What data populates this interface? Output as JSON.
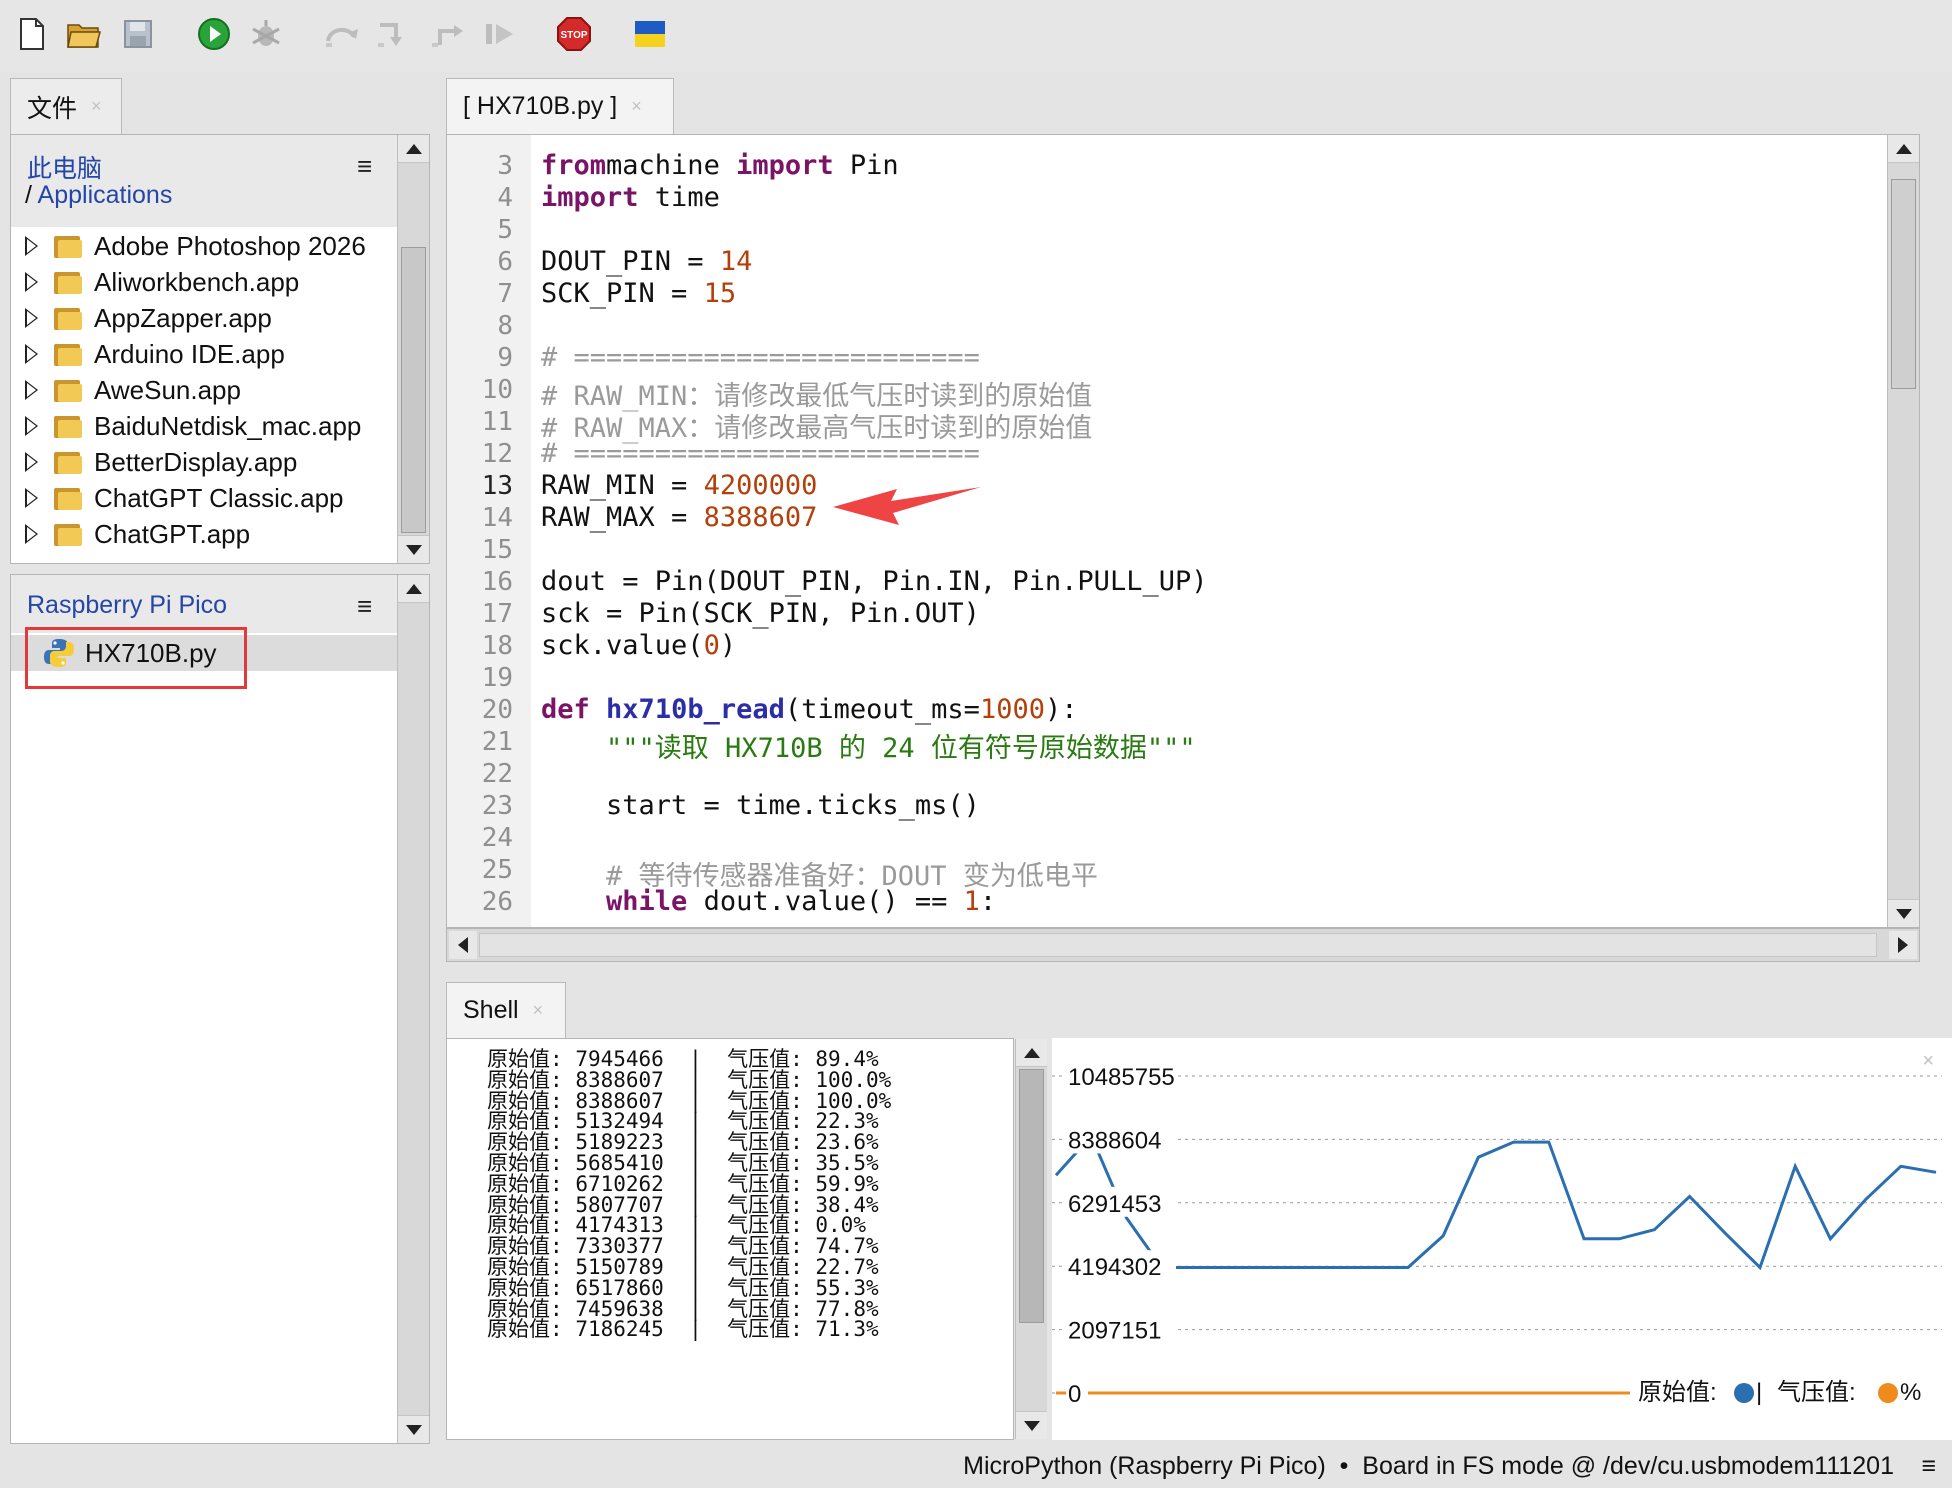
{
  "toolbar": {
    "icons": [
      "new-file-icon",
      "open-folder-icon",
      "save-icon",
      "run-icon",
      "debug-icon",
      "step-over-icon",
      "step-into-icon",
      "step-out-icon",
      "resume-icon",
      "stop-icon",
      "flag-icon"
    ],
    "stop_text": "STOP"
  },
  "files_tab": {
    "label": "文件",
    "close": "×"
  },
  "computer": {
    "title": "此电脑",
    "path_sep": "/",
    "path": "Applications",
    "items": [
      "Adobe Photoshop 2026",
      "Aliworkbench.app",
      "AppZapper.app",
      "Arduino IDE.app",
      "AweSun.app",
      "BaiduNetdisk_mac.app",
      "BetterDisplay.app",
      "ChatGPT Classic.app",
      "ChatGPT.app"
    ]
  },
  "device": {
    "title": "Raspberry Pi Pico",
    "file": "HX710B.py"
  },
  "editor_tab": {
    "label": "[ HX710B.py ]",
    "close": "×"
  },
  "editor": {
    "lines": [
      {
        "n": "3",
        "parts": [
          [
            "kw",
            "from"
          ],
          [
            "",
            "machine "
          ],
          [
            "kw",
            "import"
          ],
          [
            "",
            " Pin"
          ]
        ]
      },
      {
        "n": "4",
        "parts": [
          [
            "kw",
            "import"
          ],
          [
            "",
            " time"
          ]
        ]
      },
      {
        "n": "5",
        "parts": []
      },
      {
        "n": "6",
        "parts": [
          [
            "",
            "DOUT_PIN = "
          ],
          [
            "num",
            "14"
          ]
        ]
      },
      {
        "n": "7",
        "parts": [
          [
            "",
            "SCK_PIN = "
          ],
          [
            "num",
            "15"
          ]
        ]
      },
      {
        "n": "8",
        "parts": []
      },
      {
        "n": "9",
        "parts": [
          [
            "cm",
            "# ========================="
          ]
        ]
      },
      {
        "n": "10",
        "parts": [
          [
            "cm",
            "# RAW_MIN：请修改最低气压时读到的原始值"
          ]
        ]
      },
      {
        "n": "11",
        "parts": [
          [
            "cm",
            "# RAW_MAX：请修改最高气压时读到的原始值"
          ]
        ]
      },
      {
        "n": "12",
        "parts": [
          [
            "cm",
            "# ========================="
          ]
        ]
      },
      {
        "n": "13",
        "parts": [
          [
            "",
            "RAW_MIN = "
          ],
          [
            "num",
            "4200000"
          ]
        ]
      },
      {
        "n": "14",
        "parts": [
          [
            "",
            "RAW_MAX = "
          ],
          [
            "num",
            "8388607"
          ]
        ]
      },
      {
        "n": "15",
        "parts": []
      },
      {
        "n": "16",
        "parts": [
          [
            "",
            "dout = Pin(DOUT_PIN, Pin.IN, Pin.PULL_UP)"
          ]
        ]
      },
      {
        "n": "17",
        "parts": [
          [
            "",
            "sck = Pin(SCK_PIN, Pin.OUT)"
          ]
        ]
      },
      {
        "n": "18",
        "parts": [
          [
            "",
            "sck.value("
          ],
          [
            "num",
            "0"
          ],
          [
            "",
            ")"
          ]
        ]
      },
      {
        "n": "19",
        "parts": []
      },
      {
        "n": "20",
        "parts": [
          [
            "kw",
            "def"
          ],
          [
            "",
            " "
          ],
          [
            "fn",
            "hx710b_read"
          ],
          [
            "",
            "(timeout_ms="
          ],
          [
            "num",
            "1000"
          ],
          [
            "",
            "):"
          ]
        ]
      },
      {
        "n": "21",
        "parts": [
          [
            "",
            "    "
          ],
          [
            "str",
            "\"\"\"读取 HX710B 的 24 位有符号原始数据\"\"\""
          ]
        ]
      },
      {
        "n": "22",
        "parts": []
      },
      {
        "n": "23",
        "parts": [
          [
            "",
            "    start = time.ticks_ms()"
          ]
        ]
      },
      {
        "n": "24",
        "parts": []
      },
      {
        "n": "25",
        "parts": [
          [
            "",
            "    "
          ],
          [
            "cm",
            "# 等待传感器准备好：DOUT 变为低电平"
          ]
        ]
      },
      {
        "n": "26",
        "parts": [
          [
            "",
            "    "
          ],
          [
            "kw",
            "while"
          ],
          [
            "",
            " dout.value() == "
          ],
          [
            "num",
            "1"
          ],
          [
            "",
            ":"
          ]
        ]
      }
    ]
  },
  "shell_tab": {
    "label": "Shell",
    "close": "×"
  },
  "shell": {
    "raw_label": "原始值:",
    "pressure_label": "气压值:",
    "sep": "|",
    "rows": [
      {
        "raw": "7945466",
        "p": "89.4%"
      },
      {
        "raw": "8388607",
        "p": "100.0%"
      },
      {
        "raw": "8388607",
        "p": "100.0%"
      },
      {
        "raw": "5132494",
        "p": "22.3%"
      },
      {
        "raw": "5189223",
        "p": "23.6%"
      },
      {
        "raw": "5685410",
        "p": "35.5%"
      },
      {
        "raw": "6710262",
        "p": "59.9%"
      },
      {
        "raw": "5807707",
        "p": "38.4%"
      },
      {
        "raw": "4174313",
        "p": "0.0%"
      },
      {
        "raw": "7330377",
        "p": "74.7%"
      },
      {
        "raw": "5150789",
        "p": "22.7%"
      },
      {
        "raw": "6517860",
        "p": "55.3%"
      },
      {
        "raw": "7459638",
        "p": "77.8%"
      },
      {
        "raw": "7186245",
        "p": "71.3%"
      }
    ]
  },
  "plotter": {
    "close": "×",
    "legend": {
      "s1": "原始值:",
      "sep": " | ",
      "s2": "气压值:",
      "unit": "%"
    },
    "colors": {
      "raw": "#2a6fb0",
      "pressure": "#f08a1c"
    }
  },
  "chart_data": {
    "type": "line",
    "y_ticks": [
      "10485755",
      "8388604",
      "6291453",
      "4194302",
      "2097151",
      "0"
    ],
    "ylim": [
      0,
      10485755
    ],
    "grid": true,
    "legend_position": "bottom-right",
    "series": [
      {
        "name": "原始值",
        "values": [
          7200000,
          8500000,
          5800000,
          4150000,
          4150000,
          4150000,
          4150000,
          4150000,
          4150000,
          4150000,
          4150000,
          5200000,
          7800000,
          8300000,
          8300000,
          5100000,
          5100000,
          5400000,
          6500000,
          5300000,
          4150000,
          7500000,
          5100000,
          6400000,
          7500000,
          7300000
        ]
      },
      {
        "name": "气压值",
        "values": [
          0,
          0,
          0,
          0,
          0,
          0,
          0,
          0,
          0,
          0,
          0,
          0,
          0,
          0,
          0,
          0,
          0,
          0,
          0,
          0,
          0,
          0,
          0,
          0,
          0,
          0
        ]
      }
    ]
  },
  "status": {
    "text": "MicroPython (Raspberry Pi Pico)  •  Board in FS mode @ /dev/cu.usbmodem111201",
    "menu": "≡"
  }
}
